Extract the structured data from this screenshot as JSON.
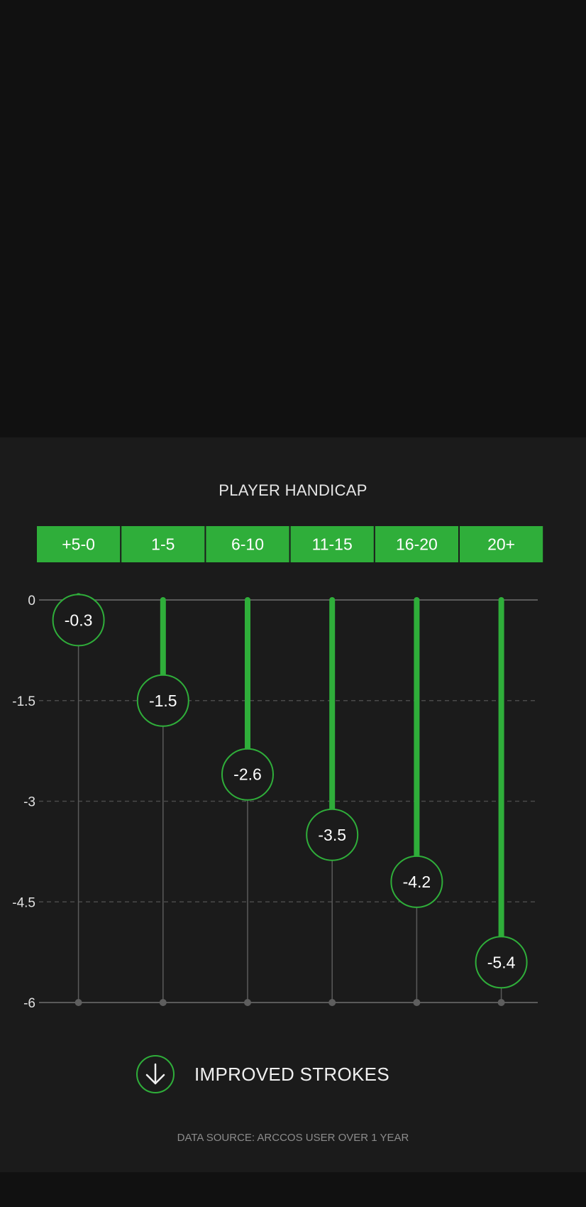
{
  "colors": {
    "accent": "#2fae3a",
    "panel_bg": "#1b1b1b",
    "page_bg": "#111111",
    "text": "#f0f0f0",
    "muted": "#8c8c8c",
    "grid": "#555555"
  },
  "chart_data": {
    "type": "bar",
    "title": "PLAYER HANDICAP",
    "categories": [
      "+5-0",
      "1-5",
      "6-10",
      "11-15",
      "16-20",
      "20+"
    ],
    "series": [
      {
        "values": [
          -0.3,
          -1.5,
          -2.6,
          -3.5,
          -4.2,
          -5.4
        ]
      }
    ],
    "data_labels": [
      "-0.3",
      "-1.5",
      "-2.6",
      "-3.5",
      "-4.2",
      "-5.4"
    ],
    "ylim": [
      -6,
      0
    ],
    "yticks": [
      0,
      -1.5,
      -3,
      -4.5,
      -6
    ],
    "ytick_labels": [
      "0",
      "-1.5",
      "-3",
      "-4.5",
      "-6"
    ],
    "grid": "dashed horizontal",
    "legend": {
      "label": "IMPROVED STROKES",
      "icon": "down-arrow-icon",
      "placement": "bottom-center"
    },
    "footnote": "DATA SOURCE: ARCCOS USER OVER 1 YEAR"
  }
}
